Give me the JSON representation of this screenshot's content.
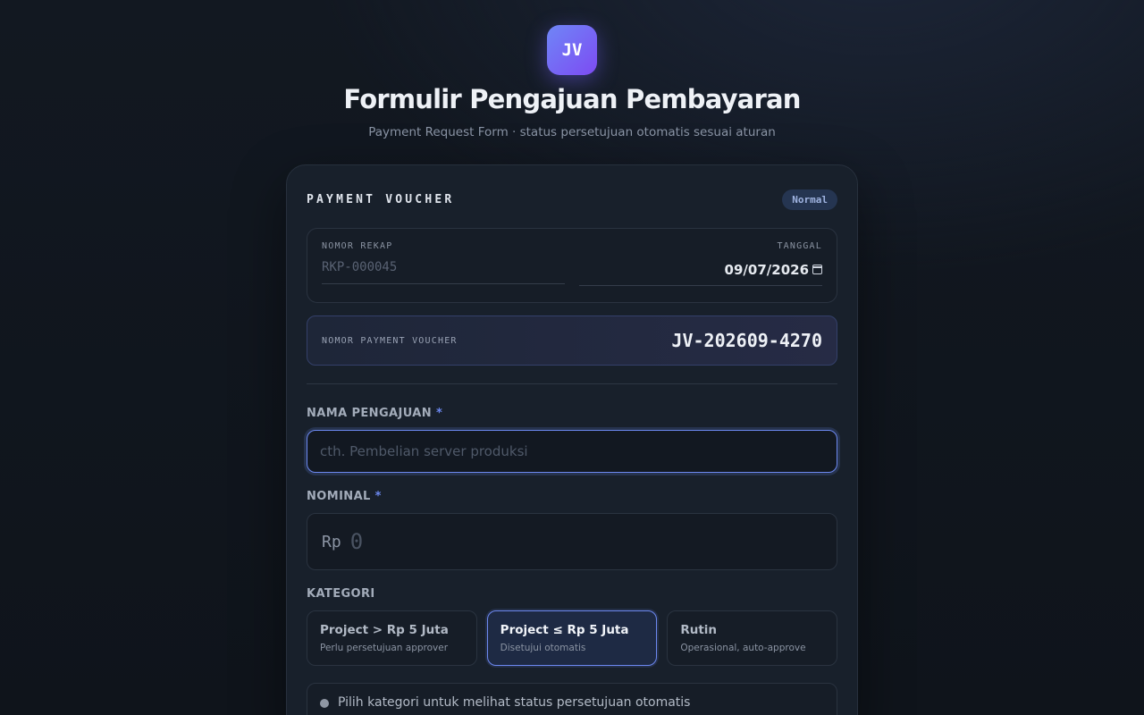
{
  "header": {
    "logo_text": "JV",
    "title": "Formulir Pengajuan Pembayaran",
    "subtitle": "Payment Request Form · status persetujuan otomatis sesuai aturan"
  },
  "voucher": {
    "heading": "PAYMENT VOUCHER",
    "priority_badge": "Normal",
    "rekap_label": "NOMOR REKAP",
    "rekap_placeholder": "RKP-000045",
    "date_label": "TANGGAL",
    "date_value": "09/07/2026",
    "pv_label": "NOMOR PAYMENT VOUCHER",
    "pv_number": "JV-202609-4270"
  },
  "form": {
    "name_label": "NAMA PENGAJUAN",
    "required_mark": "*",
    "name_placeholder": "cth. Pembelian server produksi",
    "nominal_label": "NOMINAL",
    "currency": "Rp",
    "nominal_placeholder": "0",
    "category_label": "KATEGORI",
    "categories": [
      {
        "title": "Project > Rp 5 Juta",
        "subtitle": "Perlu persetujuan approver",
        "selected": false
      },
      {
        "title": "Project ≤ Rp 5 Juta",
        "subtitle": "Disetujui otomatis",
        "selected": true
      },
      {
        "title": "Rutin",
        "subtitle": "Operasional, auto-approve",
        "selected": false
      }
    ],
    "status_text": "Pilih kategori untuk melihat status persetujuan otomatis"
  }
}
